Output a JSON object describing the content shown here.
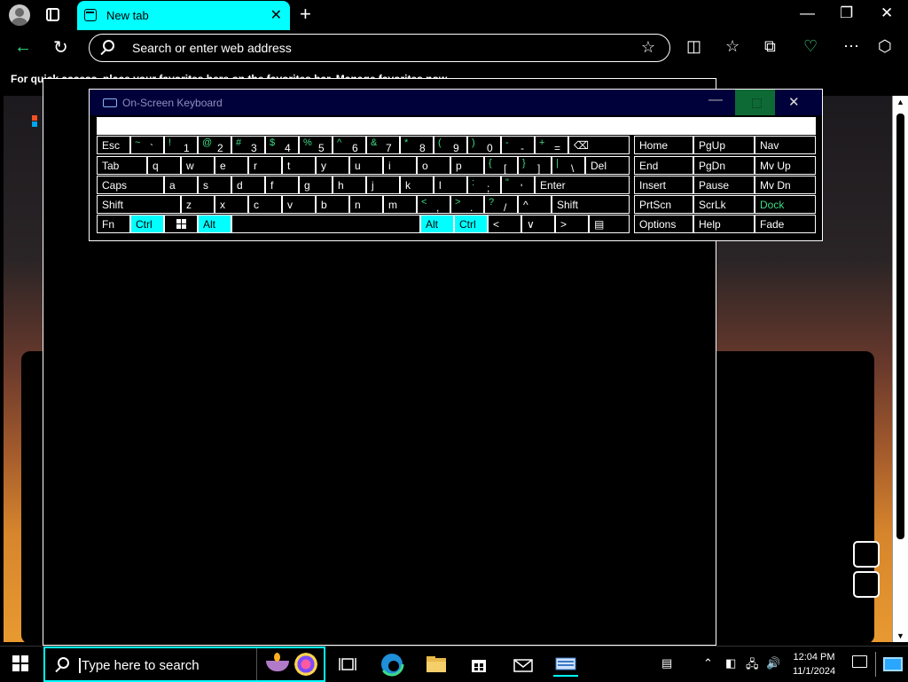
{
  "browser": {
    "tab_title": "New tab",
    "tab_close": "✕",
    "new_tab": "+",
    "address_placeholder": "Search or enter web address",
    "favorites_bar_text": "For quick access, place your favorites here on the favorites bar. Manage favorites now",
    "window_controls": {
      "minimize": "—",
      "restore": "❐",
      "close": "✕"
    },
    "toolbar_icons": [
      "split-screen-icon",
      "favorites-icon",
      "collections-icon",
      "browser-essentials-icon",
      "more-icon",
      "copilot-icon"
    ]
  },
  "osk": {
    "title": "On-Screen Keyboard",
    "row1": [
      {
        "shift": "~",
        "main": "`"
      },
      {
        "shift": "!",
        "main": "1"
      },
      {
        "shift": "@",
        "main": "2"
      },
      {
        "shift": "#",
        "main": "3"
      },
      {
        "shift": "$",
        "main": "4"
      },
      {
        "shift": "%",
        "main": "5"
      },
      {
        "shift": "^",
        "main": "6"
      },
      {
        "shift": "&",
        "main": "7"
      },
      {
        "shift": "*",
        "main": "8"
      },
      {
        "shift": "(",
        "main": "9"
      },
      {
        "shift": ")",
        "main": "0"
      },
      {
        "shift": "-",
        "main": "-"
      },
      {
        "shift": "+",
        "main": "="
      }
    ],
    "row2_letters": [
      "q",
      "w",
      "e",
      "r",
      "t",
      "y",
      "u",
      "i",
      "o",
      "p"
    ],
    "row2_sym": [
      {
        "shift": "{",
        "main": "["
      },
      {
        "shift": "}",
        "main": "]"
      },
      {
        "shift": "|",
        "main": "\\"
      }
    ],
    "row3_letters": [
      "a",
      "s",
      "d",
      "f",
      "g",
      "h",
      "j",
      "k",
      "l"
    ],
    "row3_sym": [
      {
        "shift": ":",
        "main": ";"
      },
      {
        "shift": "\"",
        "main": "'"
      }
    ],
    "row4_letters": [
      "z",
      "x",
      "c",
      "v",
      "b",
      "n",
      "m"
    ],
    "row4_sym": [
      {
        "shift": "<",
        "main": ","
      },
      {
        "shift": ">",
        "main": "."
      },
      {
        "shift": "?",
        "main": "/"
      }
    ],
    "keys": {
      "esc": "Esc",
      "tab": "Tab",
      "caps": "Caps",
      "shift": "Shift",
      "fn": "Fn",
      "ctrl": "Ctrl",
      "alt": "Alt",
      "del": "Del",
      "enter": "Enter",
      "backspace": "⌫",
      "up": "^",
      "left": "<",
      "down": "∨",
      "right": ">",
      "menu": "▤"
    },
    "nav_keys": [
      [
        "Home",
        "PgUp",
        "Nav"
      ],
      [
        "End",
        "PgDn",
        "Mv Up"
      ],
      [
        "Insert",
        "Pause",
        "Mv Dn"
      ],
      [
        "PrtScn",
        "ScrLk",
        "Dock"
      ],
      [
        "Options",
        "Help",
        "Fade"
      ]
    ]
  },
  "taskbar": {
    "search_placeholder": "Type here to search",
    "clock_time": "12:04 PM",
    "clock_date": "11/1/2024",
    "tray_icons": [
      "news-icon",
      "chevron-up-icon",
      "meet-now-icon",
      "network-icon",
      "volume-icon"
    ]
  }
}
